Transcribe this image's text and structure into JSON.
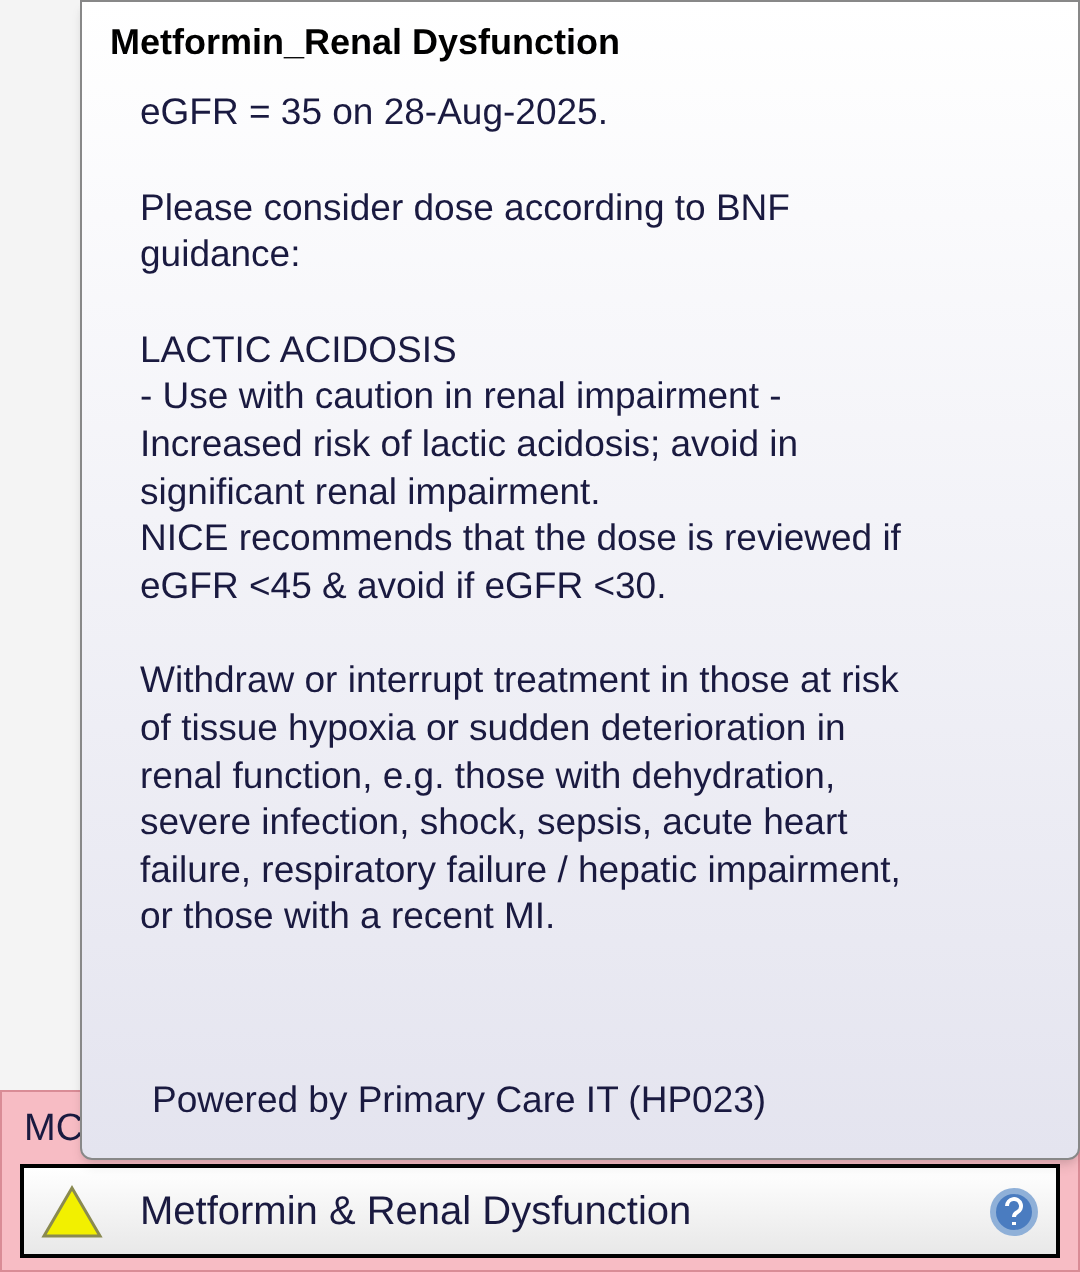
{
  "panel": {
    "label": "MC",
    "alert": {
      "text": "Metformin & Renal Dysfunction"
    }
  },
  "tooltip": {
    "title": "Metformin_Renal Dysfunction",
    "paragraphs": [
      {
        "lines": [
          "eGFR = 35 on 28-Aug-2025."
        ]
      },
      {
        "lines": [
          "Please consider dose according to BNF",
          "guidance:"
        ]
      },
      {
        "lines": [
          "LACTIC ACIDOSIS",
          "- Use with caution in renal impairment -",
          "Increased risk of lactic acidosis; avoid in",
          "significant renal impairment.",
          "NICE recommends that the dose is reviewed if",
          "eGFR <45 & avoid if eGFR <30."
        ]
      },
      {
        "lines": [
          "Withdraw or interrupt treatment in those at risk",
          "of tissue hypoxia or sudden deterioration in",
          "renal function, e.g. those with dehydration,",
          "severe infection, shock, sepsis, acute heart",
          "failure, respiratory failure / hepatic impairment,",
          "or those with a recent MI."
        ]
      }
    ],
    "footer": "Powered by Primary Care IT (HP023)"
  }
}
